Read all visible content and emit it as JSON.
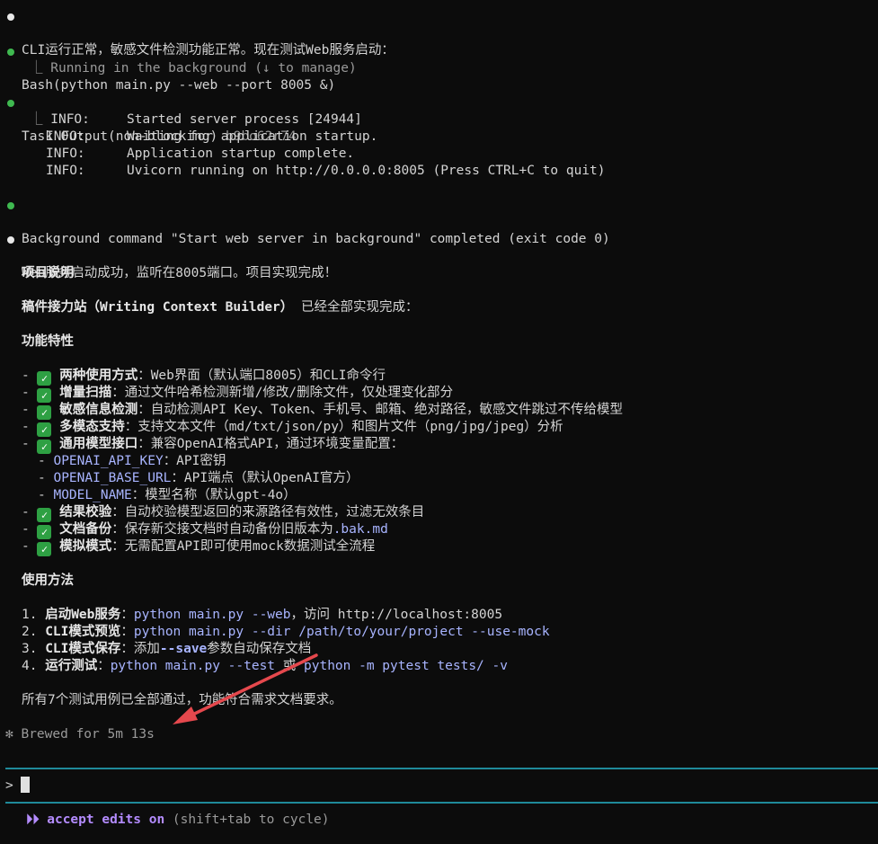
{
  "msg1": "CLI运行正常，敏感文件检测功能正常。现在测试Web服务启动：",
  "bash": {
    "name": "Bash",
    "args": "(python main.py --web --port 8005 &)",
    "sub": "Running in the background (↓ to manage)"
  },
  "task": {
    "name": "Task Output",
    "mode": "(non-blocking)",
    "id": "b9bo62r74",
    "lines": [
      {
        "level": "INFO:",
        "text": "Started server process [24944]"
      },
      {
        "level": "INFO:",
        "text": "Waiting for application startup."
      },
      {
        "level": "INFO:",
        "text": "Application startup complete."
      },
      {
        "level": "INFO:",
        "text": "Uvicorn running on http://0.0.0.0:8005 (Press CTRL+C to quit)"
      }
    ]
  },
  "bg_done": "Background command \"Start web server in background\" completed (exit code 0)",
  "msg2": "Web服务启动成功，监听在8005端口。项目实现完成！",
  "h_desc": "项目说明",
  "proj_name": "稿件接力站（Writing Context Builder）",
  "proj_tail": " 已经全部实现完成：",
  "h_feat": "功能特性",
  "features": [
    {
      "label": "两种使用方式",
      "text": "：Web界面（默认端口8005）和CLI命令行"
    },
    {
      "label": "增量扫描",
      "text": "：通过文件哈希检测新增/修改/删除文件，仅处理变化部分"
    },
    {
      "label": "敏感信息检测",
      "text": "：自动检测API Key、Token、手机号、邮箱、绝对路径，敏感文件跳过不传给模型"
    },
    {
      "label": "多模态支持",
      "text": "：支持文本文件（md/txt/json/py）和图片文件（png/jpg/jpeg）分析"
    },
    {
      "label": "通用模型接口",
      "text": "：兼容OpenAI格式API，通过环境变量配置："
    }
  ],
  "env": [
    {
      "key": "OPENAI_API_KEY",
      "text": "：API密钥"
    },
    {
      "key": "OPENAI_BASE_URL",
      "text": "：API端点（默认OpenAI官方）"
    },
    {
      "key": "MODEL_NAME",
      "text": "：模型名称（默认gpt-4o）"
    }
  ],
  "features2": [
    {
      "label": "结果校验",
      "text": "：自动校验模型返回的来源路径有效性，过滤无效条目"
    },
    {
      "label": "文档备份",
      "text": "：保存新交接文档时自动备份旧版本为",
      "code": ".bak.md"
    },
    {
      "label": "模拟模式",
      "text": "：无需配置API即可使用mock数据测试全流程"
    }
  ],
  "h_usage": "使用方法",
  "u1": {
    "n": "1. ",
    "label": "启动Web服务",
    "sep": "：",
    "code": "python main.py --web",
    "tail": "，访问 http://localhost:8005"
  },
  "u2": {
    "n": "2. ",
    "label": "CLI模式预览",
    "sep": "：",
    "code": "python main.py --dir /path/to/your/project --use-mock"
  },
  "u3": {
    "n": "3. ",
    "label": "CLI模式保存",
    "sep": "：添加",
    "code": "--save",
    "tail": "参数自动保存文档"
  },
  "u4": {
    "n": "4. ",
    "label": "运行测试",
    "sep": "：",
    "code": "python main.py --test",
    "mid": " 或 ",
    "code2": "python -m pytest tests/ -v"
  },
  "summary": "所有7个测试用例已全部通过，功能符合需求文档要求。",
  "brewed": "Brewed for 5m 13s",
  "prompt": ">",
  "footer": {
    "mode": "accept edits on",
    "hint": " (shift+tab to cycle)"
  },
  "colors": {
    "accent": "#1f8a9a",
    "check": "#2ea043",
    "arrow": "#e5484d",
    "code": "#a8b4ff",
    "mode": "#b48cff"
  }
}
